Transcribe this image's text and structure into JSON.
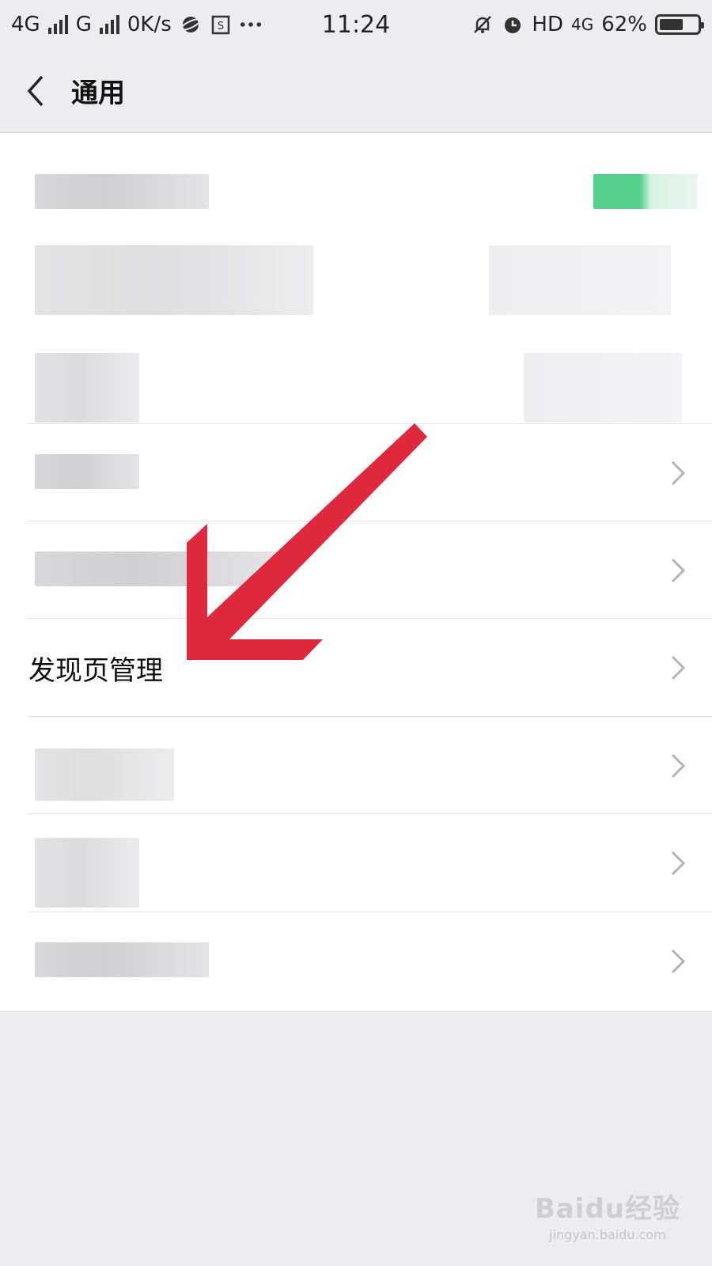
{
  "status_bar": {
    "network_1": "4G",
    "network_2": "G",
    "speed": "0K/s",
    "time": "11:24",
    "hd": "HD",
    "network_3": "4G",
    "battery": "62%",
    "battery_level": 0.62
  },
  "header": {
    "title": "通用",
    "back_icon": "chevron-left-icon"
  },
  "list": {
    "items": [
      {
        "label": "",
        "blurred": true,
        "has_chevron": false
      },
      {
        "label": "",
        "blurred": true,
        "has_chevron": false
      },
      {
        "label": "",
        "blurred": true,
        "has_chevron": false
      },
      {
        "label": "",
        "blurred": true,
        "has_chevron": true
      },
      {
        "label": "",
        "blurred": true,
        "has_chevron": true
      },
      {
        "label": "发现页管理",
        "blurred": false,
        "has_chevron": true
      },
      {
        "label": "",
        "blurred": true,
        "has_chevron": true
      },
      {
        "label": "",
        "blurred": true,
        "has_chevron": true
      },
      {
        "label": "",
        "blurred": true,
        "has_chevron": true
      }
    ]
  },
  "annotation": {
    "arrow_color": "#e0283c",
    "target": "发现页管理"
  },
  "watermark": {
    "brand": "Baidu经验",
    "url": "jingyan.baidu.com"
  },
  "colors": {
    "background": "#ededf0",
    "list_background": "#ffffff",
    "toggle_green": "#53d08c"
  }
}
